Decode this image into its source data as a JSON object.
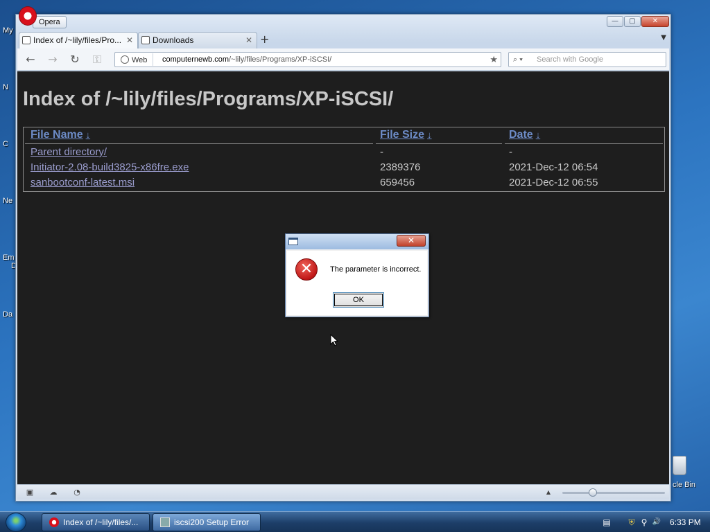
{
  "desktop": {
    "icon_labels": [
      "My",
      "N",
      "C",
      "Ne",
      "Em",
      "D",
      "Da"
    ],
    "recycle_bin_label": "cle Bin"
  },
  "browser": {
    "menu_label": "Opera",
    "window_buttons": [
      "—",
      "▢",
      "✕"
    ],
    "tabs": [
      {
        "title": "Index of /~lily/files/Pro...",
        "close": "✕"
      },
      {
        "title": "Downloads",
        "close": "✕"
      }
    ],
    "new_tab": "+",
    "tab_menu": "▼",
    "toolbar": {
      "back": "←",
      "forward": "→",
      "reload": "↻",
      "key": "⚿",
      "address_badge": "Web",
      "url_host": "computernewb.com",
      "url_path": "/~lily/files/Programs/XP-iSCSI/",
      "star": "★",
      "search_placeholder": "Search with Google",
      "search_icon": "⌕ ▾"
    },
    "page": {
      "title": "Index of /~lily/files/Programs/XP-iSCSI/",
      "columns": [
        {
          "label": "File Name",
          "sort": "↓"
        },
        {
          "label": "File Size",
          "sort": "↓"
        },
        {
          "label": "Date",
          "sort": "↓"
        }
      ],
      "rows": [
        {
          "name": "Parent directory/",
          "size": "-",
          "date": "-"
        },
        {
          "name": "Initiator-2.08-build3825-x86fre.exe",
          "size": "2389376",
          "date": "2021-Dec-12 06:54"
        },
        {
          "name": "sanbootconf-latest.msi",
          "size": "659456",
          "date": "2021-Dec-12 06:55"
        }
      ]
    },
    "statusbar": {
      "panel_icon": "▣",
      "cloud_icon": "☁",
      "speed_icon": "◔",
      "scroll_up": "▲",
      "zoom_level": 0.28
    }
  },
  "dialog": {
    "close": "✕",
    "error_glyph": "✕",
    "message": "The parameter is incorrect.",
    "ok_label": "OK"
  },
  "taskbar": {
    "items": [
      {
        "label": "Index of /~lily/files/...",
        "icon": "opera-icon"
      },
      {
        "label": "iscsi200 Setup Error",
        "icon": "setup-icon"
      }
    ],
    "tray": [
      "▤",
      "⛨",
      "⚲",
      "🔊"
    ],
    "clock": "6:33 PM"
  },
  "colors": {
    "page_background": "#1e1e1e",
    "link": "#9a9ccd",
    "header_link": "#6d8cc8",
    "error_red": "#c01717"
  }
}
